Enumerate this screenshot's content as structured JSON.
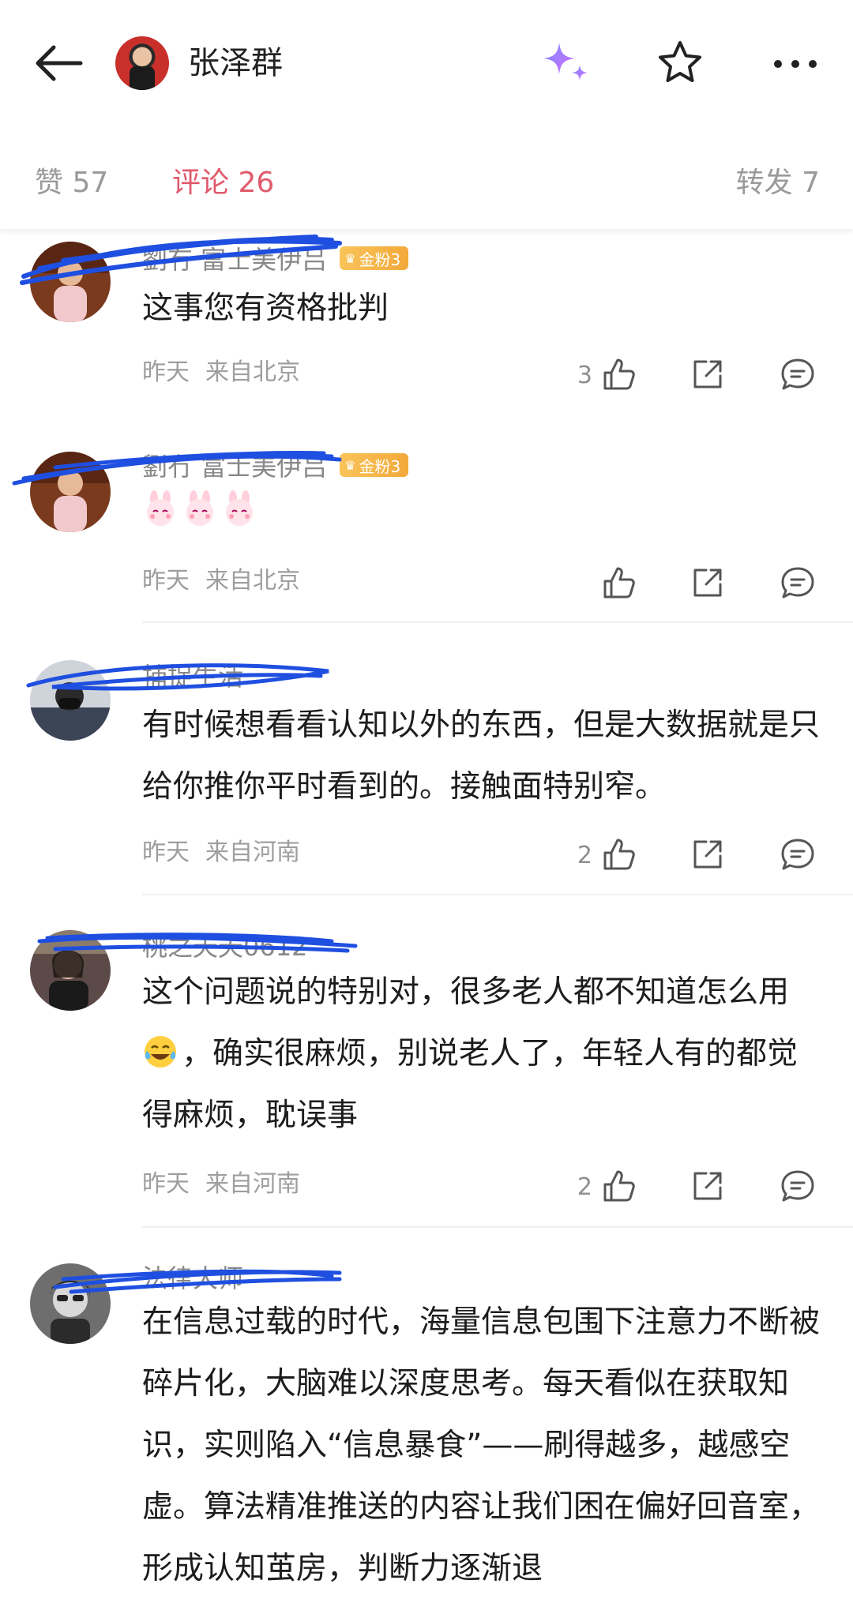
{
  "header": {
    "title": "张泽群",
    "back_icon": "back-arrow-icon",
    "sparkle_icon": "ai-sparkle-icon",
    "star_icon": "star-icon",
    "more_icon": "more-dots-icon"
  },
  "tabs": [
    {
      "label": "赞 57"
    },
    {
      "label": "评论 26",
      "active": true
    },
    {
      "label": "转发 7"
    }
  ],
  "colors": {
    "accent": "#e05a6b",
    "meta": "#9e9e9e",
    "badge": "#f2a93a",
    "scribble": "#1f4fe0"
  },
  "comments": [
    {
      "name": "劉冇 富士美伊吕",
      "badge": "金粉3",
      "text": "这事您有资格批判",
      "time": "昨天",
      "location": "来自北京",
      "likes": "3"
    },
    {
      "name": "劉冇 富士美伊吕",
      "badge": "金粉3",
      "text": "",
      "time": "昨天",
      "location": "来自北京",
      "likes": ""
    },
    {
      "name": "捕捉生活",
      "badge": "",
      "text": "有时候想看看认知以外的东西，但是大数据就是只给你推你平时看到的。接触面特别窄。",
      "time": "昨天",
      "location": "来自河南",
      "likes": "2"
    },
    {
      "name": "桃之夭夭0612",
      "badge": "",
      "text_before": "这个问题说的特别对，很多老人都不知道怎么用",
      "text_after": "，确实很麻烦，别说老人了，年轻人有的都觉得麻烦，耽误事",
      "time": "昨天",
      "location": "来自河南",
      "likes": "2"
    },
    {
      "name": "法律大师",
      "badge": "",
      "text": "在信息过载的时代，海量信息包围下注意力不断被碎片化，大脑难以深度思考。每天看似在获取知识，实则陷入“信息暴食”——刷得越多，越感空虚。算法精准推送的内容让我们困在偏好回音室，形成认知茧房，判断力逐渐退"
    }
  ]
}
